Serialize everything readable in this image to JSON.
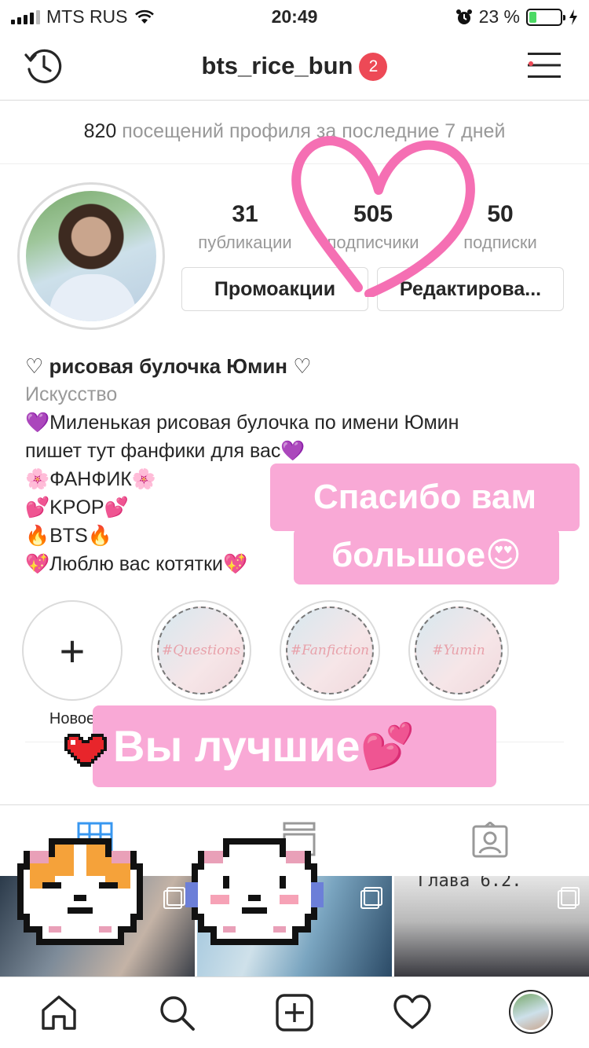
{
  "status_bar": {
    "carrier": "MTS RUS",
    "time": "20:49",
    "battery_percent": "23 %",
    "battery_level": 0.23
  },
  "header": {
    "username": "bts_rice_bun",
    "notification_count": "2"
  },
  "visits": {
    "count": "820",
    "text": "посещений профиля за последние 7 дней"
  },
  "stats": [
    {
      "value": "31",
      "label": "публикации"
    },
    {
      "value": "505",
      "label": "подписчики"
    },
    {
      "value": "50",
      "label": "подписки"
    }
  ],
  "buttons": {
    "promo": "Промоакции",
    "edit": "Редактирова..."
  },
  "bio": {
    "name": "♡ рисовая булочка Юмин ♡",
    "category": "Искусство",
    "lines": [
      "💜Миленькая рисовая булочка по имени Юмин",
      "пишет тут фанфики для вас💜",
      "🌸ФАНФИК🌸",
      "💕KPOP💕",
      "🔥BTS🔥",
      "💖Люблю вас котятки💖"
    ]
  },
  "highlights": [
    {
      "label": "Новое",
      "icon": "plus-icon"
    },
    {
      "text": "#Questions"
    },
    {
      "text": "#Fanfiction"
    },
    {
      "text": "#Yumin"
    }
  ],
  "posts": [
    {
      "caption": ""
    },
    {
      "caption": ""
    },
    {
      "caption": "Глава 6.2."
    }
  ],
  "stickers": {
    "thanks_line1": "Спасибо вам",
    "thanks_line2": "большое😍",
    "best": "Вы лучшие💕"
  },
  "colors": {
    "notification_badge": "#ed4956",
    "sticker_pink": "#f9a9d6",
    "heart_doodle": "#f56fb3",
    "battery": "#4cd964"
  },
  "icons": [
    "history-icon",
    "menu-icon",
    "grid-icon",
    "list-icon",
    "tagged-icon",
    "home-icon",
    "search-icon",
    "add-post-icon",
    "activity-heart-icon"
  ]
}
